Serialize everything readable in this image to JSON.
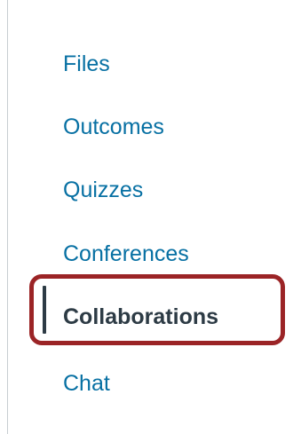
{
  "course_nav": {
    "items": [
      {
        "label": "Files",
        "active": false
      },
      {
        "label": "Outcomes",
        "active": false
      },
      {
        "label": "Quizzes",
        "active": false
      },
      {
        "label": "Conferences",
        "active": false
      },
      {
        "label": "Collaborations",
        "active": true
      },
      {
        "label": "Chat",
        "active": false
      }
    ]
  },
  "colors": {
    "link": "#0770a3",
    "active_text": "#2d3b45",
    "highlight_border": "#9b2426",
    "divider": "#c7cdd1"
  }
}
